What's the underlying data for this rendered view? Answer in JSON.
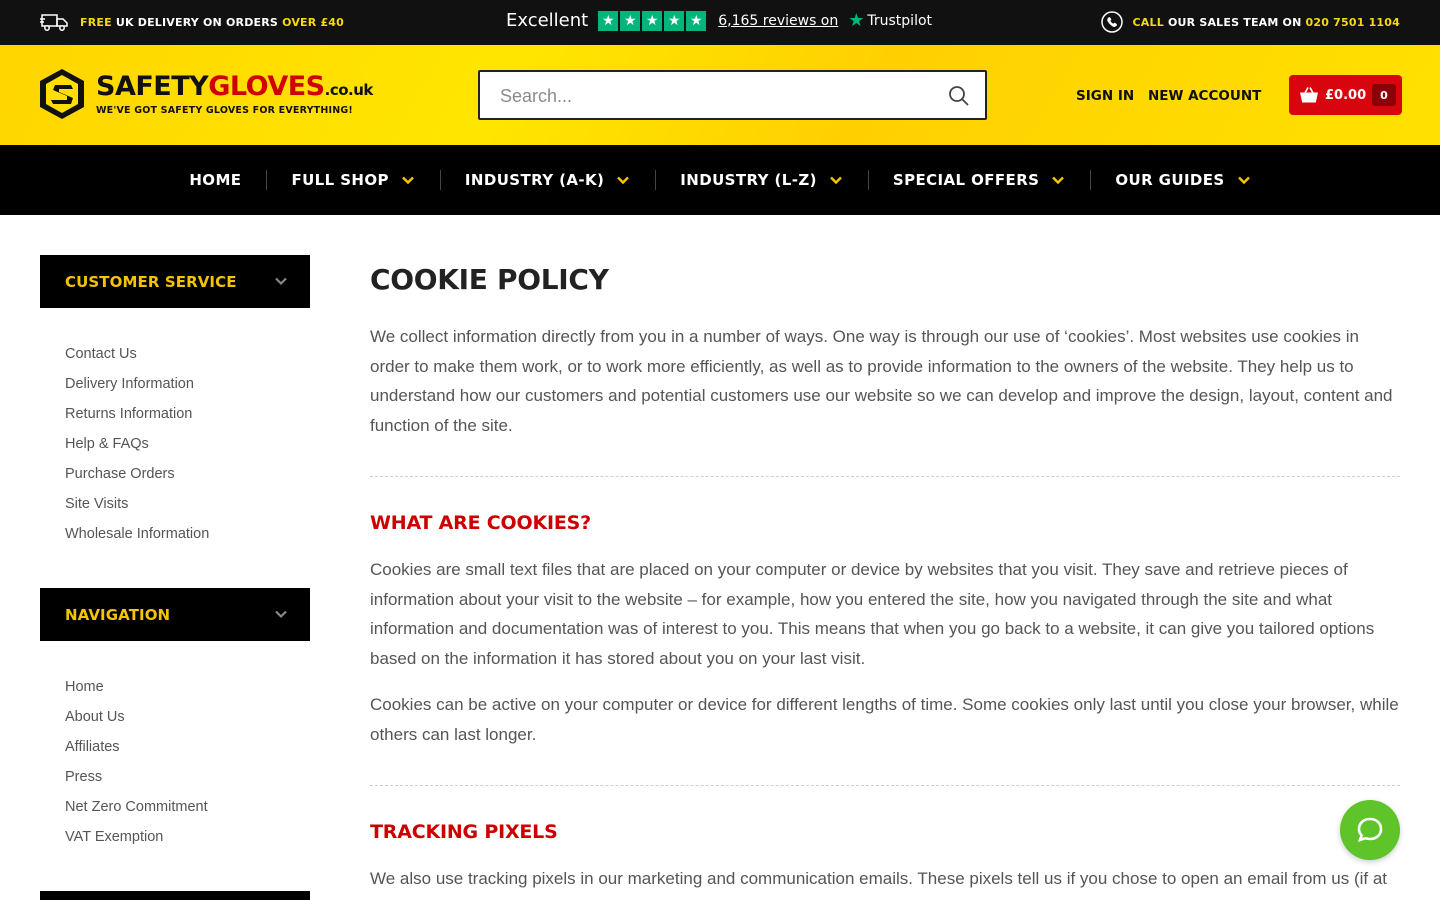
{
  "topbar": {
    "delivery_prefix": "FREE",
    "delivery_middle": " UK DELIVERY ON ORDERS ",
    "delivery_amount": "OVER £40",
    "rating_word": "Excellent",
    "reviews_text": "6,165 reviews on",
    "trustpilot_label": "Trustpilot",
    "call_prefix": "CALL",
    "call_middle": " OUR SALES TEAM ON ",
    "call_number": "020 7501 1104"
  },
  "header": {
    "logo_safety": "SAFETY",
    "logo_gloves": "GLOVES",
    "logo_tld": ".co.uk",
    "logo_tagline": "WE'VE GOT SAFETY GLOVES FOR EVERYTHING!",
    "search_placeholder": "Search...",
    "sign_in": "SIGN IN",
    "new_account": "NEW ACCOUNT",
    "cart_amount": "£0.00",
    "cart_count": "0"
  },
  "nav": {
    "items": [
      {
        "label": "HOME"
      },
      {
        "label": "FULL SHOP"
      },
      {
        "label": "INDUSTRY (A-K)"
      },
      {
        "label": "INDUSTRY (L-Z)"
      },
      {
        "label": "SPECIAL OFFERS"
      },
      {
        "label": "OUR GUIDES"
      }
    ]
  },
  "sidebar": {
    "customer_service": {
      "title": "CUSTOMER SERVICE",
      "items": [
        "Contact Us",
        "Delivery Information",
        "Returns Information",
        "Help & FAQs",
        "Purchase Orders",
        "Site Visits",
        "Wholesale Information"
      ]
    },
    "navigation": {
      "title": "NAVIGATION",
      "items": [
        "Home",
        "About Us",
        "Affiliates",
        "Press",
        "Net Zero Commitment",
        "VAT Exemption"
      ]
    }
  },
  "content": {
    "title": "COOKIE POLICY",
    "intro": "We collect information directly from you in a number of ways. One way is through our use of ‘cookies’. Most websites use cookies in order to make them work, or to work more efficiently, as well as to provide information to the owners of the website. They help us to understand how our customers and potential customers use our website so we can develop and improve the design, layout, content and function of the site.",
    "section1_title": "WHAT ARE COOKIES?",
    "section1_p1": "Cookies are small text files that are placed on your computer or device by websites that you visit. They save and retrieve pieces of information about your visit to the website – for example, how you entered the site, how you navigated through the site and what information and documentation was of interest to you. This means that when you go back to a website, it can give you tailored options based on the information it has stored about you on your last visit.",
    "section1_p2": "Cookies can be active on your computer or device for different lengths of time. Some cookies only last until you close your browser, while others can last longer.",
    "section2_title": "TRACKING PIXELS",
    "section2_p1": "We also use tracking pixels in our marketing and communication emails. These pixels tell us if you chose to open an email from us (if at"
  },
  "colors": {
    "brand_yellow": "#ffde00",
    "brand_red": "#d8050f",
    "heading_red": "#cc0000",
    "trustpilot_green": "#00b67a",
    "chat_green": "#5ec429"
  },
  "icons": {
    "delivery": "delivery-truck-icon",
    "phone": "phone-icon",
    "search": "search-icon",
    "cart": "basket-icon",
    "chevron": "chevron-down-icon",
    "chat": "chat-bubble-icon"
  }
}
